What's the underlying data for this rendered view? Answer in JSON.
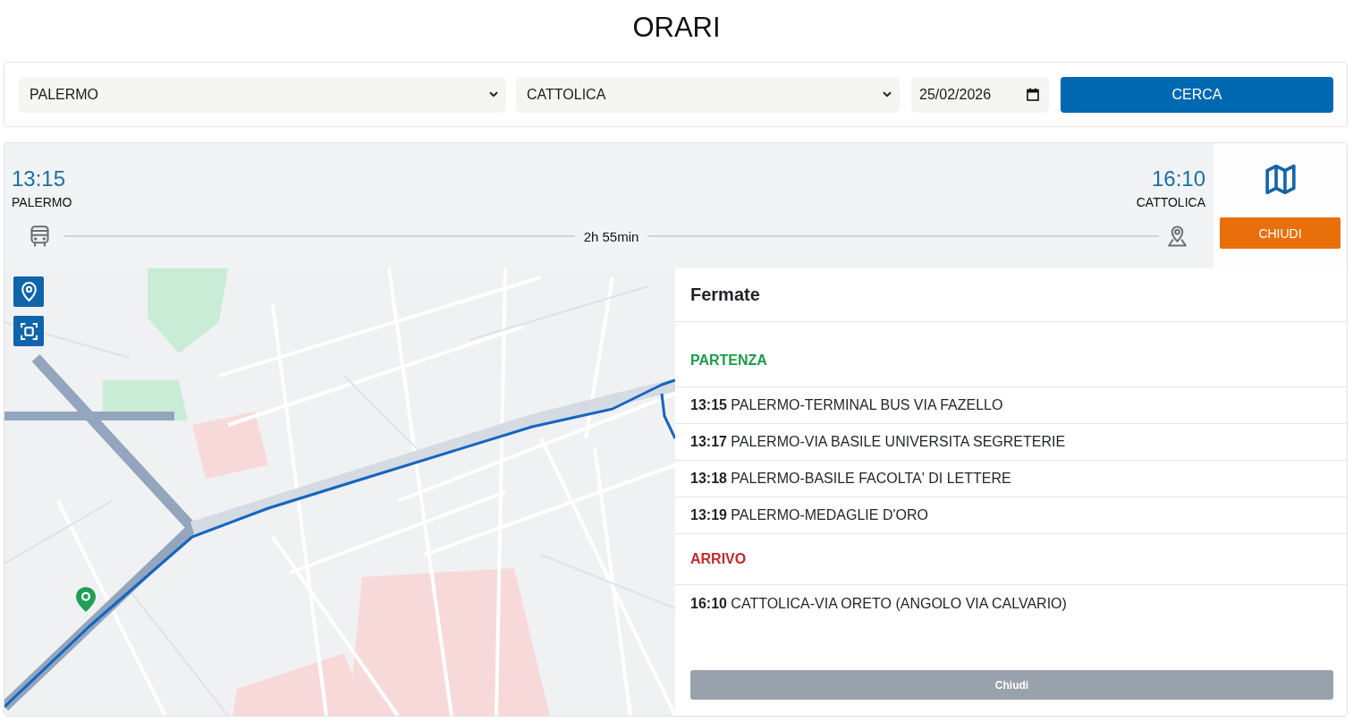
{
  "page": {
    "title": "ORARI"
  },
  "search": {
    "from": {
      "value": "PALERMO"
    },
    "to": {
      "value": "CATTOLICA"
    },
    "date": {
      "value": "25/02/2026"
    },
    "button": "CERCA"
  },
  "trip": {
    "departure": {
      "time": "13:15",
      "place": "PALERMO"
    },
    "arrival": {
      "time": "16:10",
      "place": "CATTOLICA"
    },
    "duration": "2h 55min",
    "close_button": "CHIUDI"
  },
  "stops_panel": {
    "title": "Fermate",
    "sections": [
      {
        "heading": "PARTENZA",
        "color": "#1a9c4a",
        "stops": [
          {
            "time": "13:15",
            "name": "PALERMO-TERMINAL BUS VIA FAZELLO"
          },
          {
            "time": "13:17",
            "name": "PALERMO-VIA BASILE UNIVERSITA SEGRETERIE"
          },
          {
            "time": "13:18",
            "name": "PALERMO-BASILE FACOLTA' DI LETTERE"
          },
          {
            "time": "13:19",
            "name": "PALERMO-MEDAGLIE D'ORO"
          }
        ]
      },
      {
        "heading": "ARRIVO",
        "color": "#c62828",
        "stops": [
          {
            "time": "16:10",
            "name": "CATTOLICA-VIA ORETO (ANGOLO VIA CALVARIO)"
          }
        ]
      }
    ],
    "close_button": "Chiudi"
  }
}
